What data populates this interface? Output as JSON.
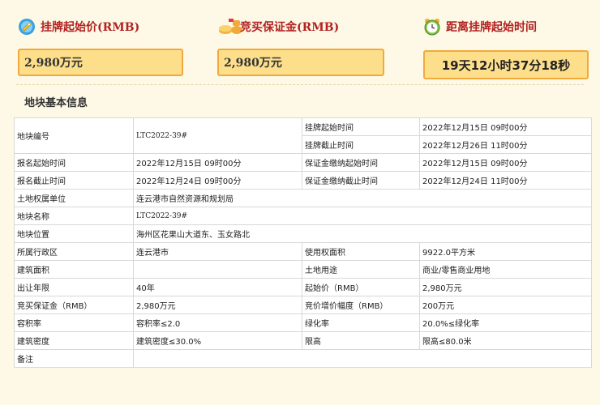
{
  "summary": {
    "start_price": {
      "label": "挂牌起始价(RMB)",
      "value": "2,980万元",
      "icon": "price-tag-icon"
    },
    "deposit": {
      "label": "竞买保证金(RMB)",
      "value": "2,980万元",
      "icon": "money-bag-icon"
    },
    "countdown": {
      "label": "距离挂牌起始时间",
      "value": "19天12小时37分18秒",
      "icon": "alarm-clock-icon"
    }
  },
  "section_title": "地块基本信息",
  "table": {
    "r1": {
      "k1": "地块编号",
      "v1": "LTC2022-39#",
      "k2a": "挂牌起始时间",
      "v2a": "2022年12月15日 09时00分",
      "k2b": "挂牌截止时间",
      "v2b": "2022年12月26日 11时00分"
    },
    "r2": {
      "k1": "报名起始时间",
      "v1": "2022年12月15日 09时00分",
      "k2": "保证金缴纳起始时间",
      "v2": "2022年12月15日 09时00分"
    },
    "r3": {
      "k1": "报名截止时间",
      "v1": "2022年12月24日 09时00分",
      "k2": "保证金缴纳截止时间",
      "v2": "2022年12月24日 11时00分"
    },
    "r4": {
      "k1": "土地权属单位",
      "v1": "连云港市自然资源和规划局"
    },
    "r5": {
      "k1": "地块名称",
      "v1": "LTC2022-39#"
    },
    "r6": {
      "k1": "地块位置",
      "v1": "海州区花果山大道东、玉女路北"
    },
    "r7": {
      "k1": "所属行政区",
      "v1": "连云港市",
      "k2": "使用权面积",
      "v2": "9922.0平方米"
    },
    "r8": {
      "k1": "建筑面积",
      "v1": "",
      "k2": "土地用途",
      "v2": "商业/零售商业用地"
    },
    "r9": {
      "k1": "出让年限",
      "v1": "40年",
      "k2": "起始价（RMB）",
      "v2": "2,980万元"
    },
    "r10": {
      "k1": "竞买保证金（RMB）",
      "v1": "2,980万元",
      "k2": "竞价增价幅度（RMB）",
      "v2": "200万元"
    },
    "r11": {
      "k1": "容积率",
      "v1": "容积率≤2.0",
      "k2": "绿化率",
      "v2": "20.0%≤绿化率"
    },
    "r12": {
      "k1": "建筑密度",
      "v1": "建筑密度≤30.0%",
      "k2": "限高",
      "v2": "限高≤80.0米"
    },
    "r13": {
      "k1": "备注",
      "v1": ""
    }
  },
  "colors": {
    "accent_red": "#b22222",
    "box_fill": "#fddf8b",
    "box_border": "#f2a93b",
    "page_bg": "#fdf9e6"
  }
}
